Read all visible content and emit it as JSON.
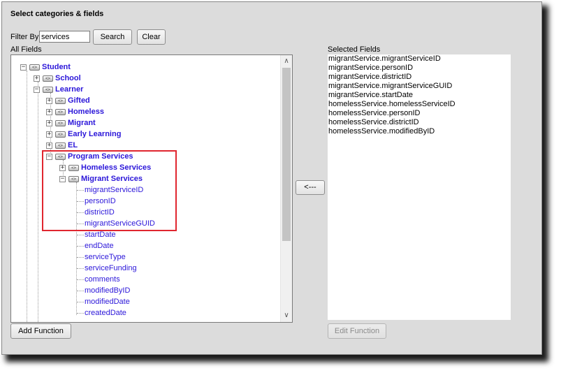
{
  "dialog": {
    "title": "Select categories & fields"
  },
  "filter": {
    "label": "Filter By",
    "value": "services",
    "search_label": "Search",
    "clear_label": "Clear"
  },
  "all_fields": {
    "label": "All Fields",
    "tree": {
      "student": "Student",
      "school": "School",
      "learner": "Learner",
      "gifted": "Gifted",
      "homeless": "Homeless",
      "migrant": "Migrant",
      "early_learning": "Early Learning",
      "el": "EL",
      "program_services": "Program Services",
      "homeless_services": "Homeless Services",
      "migrant_services": "Migrant Services",
      "fields": [
        "migrantServiceID",
        "personID",
        "districtID",
        "migrantServiceGUID",
        "startDate",
        "endDate",
        "serviceType",
        "serviceFunding",
        "comments",
        "modifiedByID",
        "modifiedDate",
        "createdDate"
      ]
    },
    "scroll_up_icon": "chevron-up-icon",
    "scroll_down_icon": "chevron-down-icon"
  },
  "transfer": {
    "remove_label": "<---"
  },
  "selected_fields": {
    "label": "Selected Fields",
    "items": [
      "migrantService.migrantServiceID",
      "migrantService.personID",
      "migrantService.districtID",
      "migrantService.migrantServiceGUID",
      "migrantService.startDate",
      "homelessService.homelessServiceID",
      "homelessService.personID",
      "homelessService.districtID",
      "homelessService.modifiedByID"
    ]
  },
  "functions": {
    "add_label": "Add Function",
    "edit_label": "Edit Function"
  },
  "colors": {
    "link": "#2b16d9",
    "highlight": "#e0262f",
    "panel_bg": "#dcdcdc"
  }
}
